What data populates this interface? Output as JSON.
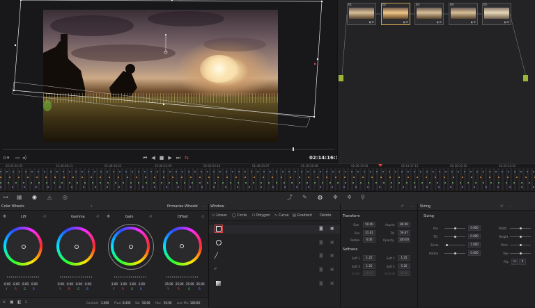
{
  "viewer": {
    "timecode": "02:14:16:12"
  },
  "nodes": {
    "items": [
      {
        "num": "01"
      },
      {
        "num": "02"
      },
      {
        "num": "03"
      },
      {
        "num": "04"
      },
      {
        "num": "05"
      }
    ]
  },
  "timeline": {
    "timecodes": [
      "02:03:30:05",
      "01:46:08:11",
      "01:48:16:22",
      "01:08:22:09",
      "02:00:23:16",
      "01:48:33:07",
      "01:18:18:08",
      "02:06:19:03",
      "02:14:17:15",
      "02:18:10:10",
      "02:20:14:02"
    ]
  },
  "color_wheels": {
    "title": "Color Wheels",
    "mode": "Primaries Wheels",
    "wheels": [
      {
        "name": "Lift",
        "values": [
          "0.00",
          "0.00",
          "0.00",
          "0.00"
        ]
      },
      {
        "name": "Gamma",
        "values": [
          "0.00",
          "0.00",
          "0.00",
          "0.00"
        ]
      },
      {
        "name": "Gain",
        "values": [
          "1.00",
          "1.00",
          "1.00",
          "1.00"
        ]
      },
      {
        "name": "Offset",
        "values": [
          "25.00",
          "25.00",
          "25.00",
          "25.00"
        ]
      }
    ],
    "channel_labels": [
      "Y",
      "R",
      "G",
      "B"
    ],
    "footer": {
      "contrast_label": "Contrast",
      "contrast": "1.000",
      "pivot_label": "Pivot",
      "pivot": "0.435",
      "sat_label": "Sat",
      "sat": "50.00",
      "hue_label": "Hue",
      "hue": "50.00",
      "lummix_label": "Lum Mix",
      "lummix": "100.00",
      "page_num": "2"
    }
  },
  "window": {
    "title": "Window",
    "tools": [
      "Linear",
      "Circle",
      "Polygon",
      "Curve",
      "Gradient"
    ],
    "delete_label": "Delete"
  },
  "transform": {
    "title": "Transform",
    "fields": [
      {
        "label": "Size",
        "value": "50.00",
        "label2": "Aspect",
        "value2": "80.00"
      },
      {
        "label": "Pan",
        "value": "31.61",
        "label2": "Tilt",
        "value2": "59.87"
      },
      {
        "label": "Rotate",
        "value": "0.00",
        "label2": "Opacity",
        "value2": "100.00"
      }
    ],
    "softness_title": "Softness",
    "softness": [
      {
        "label": "Soft 1",
        "value": "1.25",
        "label2": "Soft 2",
        "value2": "1.25"
      },
      {
        "label": "Soft 3",
        "value": "1.25",
        "label2": "Soft 4",
        "value2": "5.26"
      },
      {
        "label": "Inside",
        "value": "50.00",
        "label2": "Outside",
        "value2": "50.00"
      }
    ]
  },
  "sizing": {
    "title": "Sizing",
    "subtitle": "Sizing",
    "left": [
      {
        "label": "Pan",
        "value": "0.000"
      },
      {
        "label": "Tilt",
        "value": "0.000"
      },
      {
        "label": "Zoom",
        "value": "1.000"
      },
      {
        "label": "Rotate",
        "value": "0.000"
      }
    ],
    "right": [
      {
        "label": "Width",
        "value": ""
      },
      {
        "label": "Height",
        "value": ""
      },
      {
        "label": "Pitch",
        "value": ""
      },
      {
        "label": "Yaw",
        "value": ""
      },
      {
        "label": "Flip",
        "value": ""
      }
    ]
  }
}
